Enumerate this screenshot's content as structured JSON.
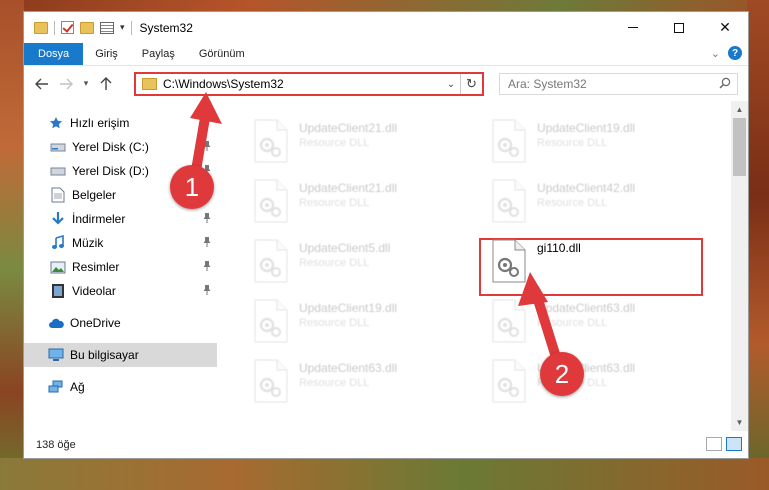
{
  "window": {
    "title": "System32",
    "controls": {
      "minimize": "",
      "maximize": "",
      "close": "✕"
    }
  },
  "ribbon": {
    "tabs": [
      "Dosya",
      "Giriş",
      "Paylaş",
      "Görünüm"
    ],
    "help": "?"
  },
  "address": {
    "path": "C:\\Windows\\System32",
    "refresh_icon": "↻"
  },
  "search": {
    "placeholder": "Ara: System32"
  },
  "sidebar": {
    "quick_access": "Hızlı erişim",
    "items": [
      {
        "label": "Yerel Disk (C:)",
        "icon": "drive-icon",
        "pinned": true
      },
      {
        "label": "Yerel Disk (D:)",
        "icon": "drive-icon",
        "pinned": true
      },
      {
        "label": "Belgeler",
        "icon": "documents-icon",
        "pinned": true
      },
      {
        "label": "İndirmeler",
        "icon": "download-icon",
        "pinned": true
      },
      {
        "label": "Müzik",
        "icon": "music-icon",
        "pinned": true
      },
      {
        "label": "Resimler",
        "icon": "pictures-icon",
        "pinned": true
      },
      {
        "label": "Videolar",
        "icon": "videos-icon",
        "pinned": true
      }
    ],
    "onedrive": "OneDrive",
    "this_pc": "Bu bilgisayar",
    "network": "Ağ"
  },
  "files": [
    {
      "name": "UpdateClient21.dll",
      "desc": "Resource DLL",
      "faded": true
    },
    {
      "name": "UpdateClient19.dll",
      "desc": "Resource DLL",
      "faded": true
    },
    {
      "name": "UpdateClient21.dll",
      "desc": "Resource DLL",
      "faded": true
    },
    {
      "name": "UpdateClient42.dll",
      "desc": "Resource DLL",
      "faded": true
    },
    {
      "name": "UpdateClient5.dll",
      "desc": "Resource DLL",
      "faded": true
    },
    {
      "name": "gi110.dll",
      "desc": "",
      "faded": false
    },
    {
      "name": "UpdateClient19.dll",
      "desc": "Resource DLL",
      "faded": true
    },
    {
      "name": "UpdateClient63.dll",
      "desc": "Resource DLL",
      "faded": true
    },
    {
      "name": "UpdateClient63.dll",
      "desc": "Resource DLL",
      "faded": true
    },
    {
      "name": "UpdateClient63.dll",
      "desc": "Resource DLL",
      "faded": true
    }
  ],
  "status": {
    "count": "138 öğe"
  },
  "callouts": {
    "one": "1",
    "two": "2"
  },
  "colors": {
    "accent": "#1979ca",
    "highlight": "#e0393b"
  }
}
